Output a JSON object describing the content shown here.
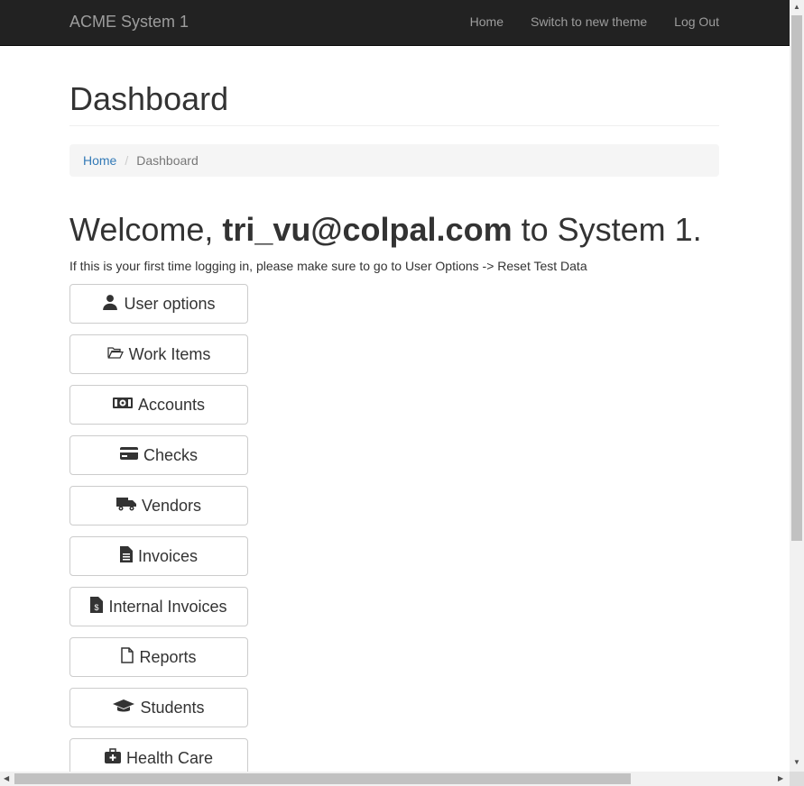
{
  "navbar": {
    "brand": "ACME System 1",
    "links": [
      "Home",
      "Switch to new theme",
      "Log Out"
    ]
  },
  "page": {
    "title": "Dashboard",
    "breadcrumb": {
      "home": "Home",
      "current": "Dashboard"
    },
    "welcome": {
      "prefix": "Welcome, ",
      "user": "tri_vu@colpal.com",
      "suffix": " to System 1."
    },
    "hint": "If this is your first time logging in, please make sure to go to User Options -> Reset Test Data"
  },
  "buttons": [
    {
      "label": "User options",
      "icon": "user-icon"
    },
    {
      "label": "Work Items",
      "icon": "folder-open-icon"
    },
    {
      "label": "Accounts",
      "icon": "money-icon"
    },
    {
      "label": "Checks",
      "icon": "credit-card-icon"
    },
    {
      "label": "Vendors",
      "icon": "truck-icon"
    },
    {
      "label": "Invoices",
      "icon": "file-text-icon"
    },
    {
      "label": "Internal Invoices",
      "icon": "file-invoice-dollar-icon"
    },
    {
      "label": "Reports",
      "icon": "file-icon"
    },
    {
      "label": "Students",
      "icon": "graduation-cap-icon"
    },
    {
      "label": "Health Care",
      "icon": "medkit-icon"
    }
  ]
}
